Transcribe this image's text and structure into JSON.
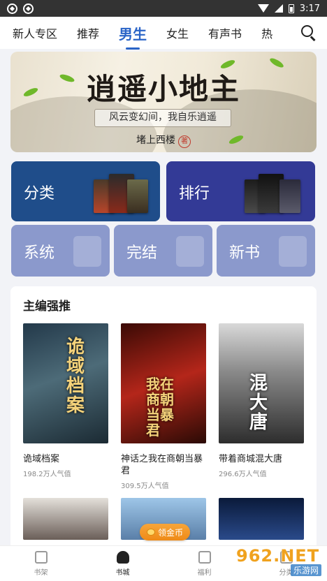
{
  "status_bar": {
    "time": "3:17"
  },
  "tabs": [
    {
      "label": "新人专区"
    },
    {
      "label": "推荐"
    },
    {
      "label": "男生"
    },
    {
      "label": "女生"
    },
    {
      "label": "有声书"
    },
    {
      "label": "热"
    }
  ],
  "banner": {
    "title": "逍遥小地主",
    "slogan": "风云变幻间，我自乐逍遥",
    "author": "堵上西楼",
    "seal": "著"
  },
  "categories": {
    "big": [
      {
        "label": "分类"
      },
      {
        "label": "排行"
      }
    ],
    "small": [
      {
        "label": "系统"
      },
      {
        "label": "完结"
      },
      {
        "label": "新书"
      }
    ]
  },
  "editor_picks": {
    "heading": "主编强推",
    "books": [
      {
        "title": "诡域档案",
        "popularity": "198.2万人气值",
        "cover_text": "诡域档案"
      },
      {
        "title": "神话之我在商朝当暴君",
        "popularity": "309.5万人气值",
        "cover_text": "我在商朝当暴君"
      },
      {
        "title": "带着商城混大唐",
        "popularity": "296.6万人气值",
        "cover_text": "混大唐"
      }
    ]
  },
  "gold_button": {
    "label": "领金币"
  },
  "bottom_nav": [
    {
      "label": "书架"
    },
    {
      "label": "书城"
    },
    {
      "label": "福利"
    },
    {
      "label": "分类"
    }
  ],
  "watermark": {
    "brand": "962.NET",
    "sub": "乐游网"
  }
}
